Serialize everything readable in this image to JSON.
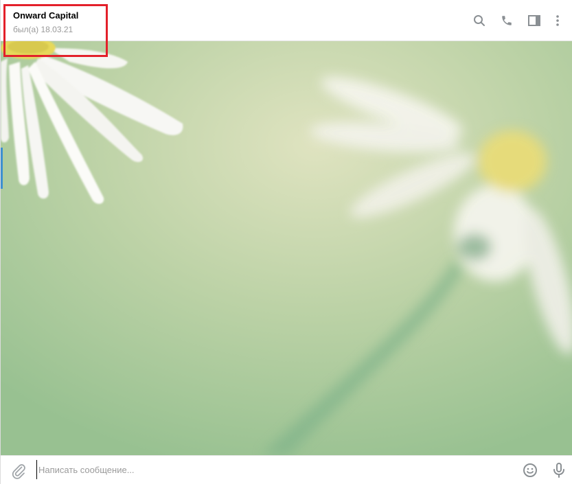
{
  "header": {
    "title": "Onward Capital",
    "status": "был(а) 18.03.21"
  },
  "header_actions": [
    {
      "name": "search-icon"
    },
    {
      "name": "phone-icon"
    },
    {
      "name": "sidebar-toggle-icon"
    },
    {
      "name": "more-vertical-icon"
    }
  ],
  "background": {
    "description_icon": "daisy-wallpaper"
  },
  "composer": {
    "placeholder": "Написать сообщение..."
  },
  "colors": {
    "highlight": "#e3202a",
    "icon": "#8a8f93",
    "accent": "#3d8fd1"
  }
}
